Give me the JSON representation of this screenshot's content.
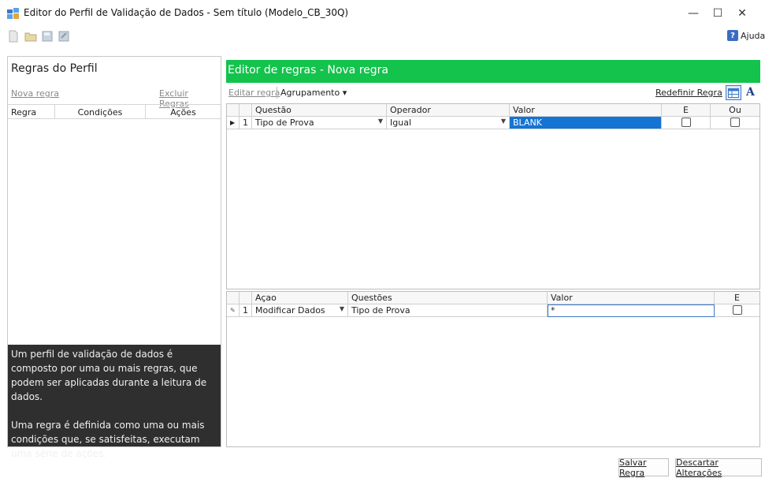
{
  "window": {
    "title": "Editor do Perfil de Validação de Dados - Sem título (Modelo_CB_30Q)",
    "minimize_glyph": "—",
    "maximize_glyph": "☐",
    "close_glyph": "✕"
  },
  "toolbar": {
    "icons": [
      "new-file-icon",
      "open-folder-icon",
      "save-icon",
      "save-as-icon"
    ],
    "help_label": "Ajuda"
  },
  "left_panel": {
    "title": "Regras do Perfil",
    "new_rule": "Nova regra",
    "delete_rules": "Excluir Regras",
    "columns": [
      "Regra",
      "Condições",
      "Ações"
    ],
    "info_paragraphs": [
      "Um perfil de validação de dados é composto por uma ou mais regras, que podem ser aplicadas durante a leitura de dados.",
      "Uma regra é definida como uma ou mais condições que, se satisfeitas, executam uma série de ações."
    ]
  },
  "editor": {
    "header": "Editor de regras - Nova regra",
    "edit_rule": "Editar regra",
    "grouping": "Agrupamento ▾",
    "reset_rule": "Redefinir Regra",
    "font_glyph": "A"
  },
  "conditions": {
    "columns": [
      "Questão",
      "Operador",
      "Valor",
      "E",
      "Ou"
    ],
    "rows": [
      {
        "marker": "▶",
        "num": "1",
        "question": "Tipo de Prova",
        "operator": "Igual",
        "value": "BLANK",
        "and": false,
        "or": false
      }
    ]
  },
  "actions": {
    "columns": [
      "Açao",
      "Questões",
      "Valor",
      "E"
    ],
    "rows": [
      {
        "marker": "✎",
        "num": "1",
        "action": "Modificar Dados",
        "questions": "Tipo de Prova",
        "value": "*",
        "and": false
      }
    ]
  },
  "buttons": {
    "save": "Salvar Regra",
    "discard": "Descartar Alterações"
  },
  "colors": {
    "header_green": "#13c34c",
    "selection_blue": "#1474d4",
    "info_dark": "#2f2f2f"
  }
}
